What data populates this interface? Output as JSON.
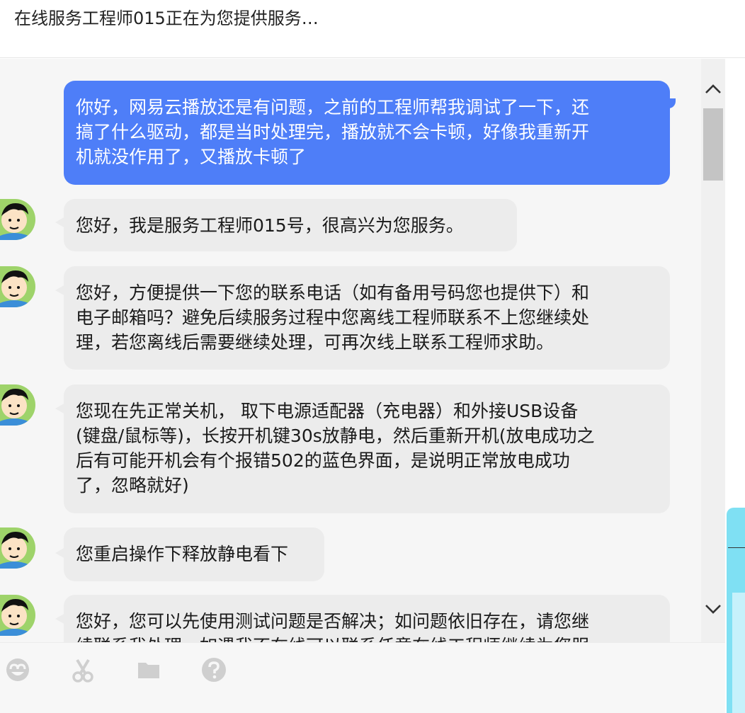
{
  "header": {
    "title": "在线服务工程师015正在为您提供服务…"
  },
  "messages": [
    {
      "sender": "user",
      "text": "你好，网易云播放还是有问题，之前的工程师帮我调试了一下，还\n搞了什么驱动，都是当时处理完，播放就不会卡顿，好像我重新开\n机就没作用了，又播放卡顿了"
    },
    {
      "sender": "agent",
      "text": "您好，我是服务工程师015号，很高兴为您服务。"
    },
    {
      "sender": "agent",
      "text": "您好，方便提供一下您的联系电话（如有备用号码您也提供下）和\n电子邮箱吗？避免后续服务过程中您离线工程师联系不上您继续处\n理，若您离线后需要继续处理，可再次线上联系工程师求助。"
    },
    {
      "sender": "agent",
      "text": "您现在先正常关机， 取下电源适配器（充电器）和外接USB设备\n(键盘/鼠标等)，长按开机键30s放静电，然后重新开机(放电成功之\n后有可能开机会有个报错502的蓝色界面，是说明正常放电成功\n了，忽略就好)"
    },
    {
      "sender": "agent",
      "text": "您重启操作下释放静电看下"
    },
    {
      "sender": "agent",
      "text": "您好，您可以先使用测试问题是否解决；如问题依旧存在，请您继\n续联系我处理，如遇我不在线可以联系任意在线工程师继续为您服"
    }
  ],
  "toolbar": {
    "icons": [
      "emoji-icon",
      "scissors-icon",
      "folder-icon",
      "help-icon"
    ]
  },
  "scrollbar": {
    "up_icon": "chevron-up-icon",
    "down_icon": "chevron-down-icon"
  },
  "colors": {
    "user_bubble": "#4e7ef8",
    "agent_bubble": "#ececec",
    "chat_background": "#f6f6f6"
  }
}
